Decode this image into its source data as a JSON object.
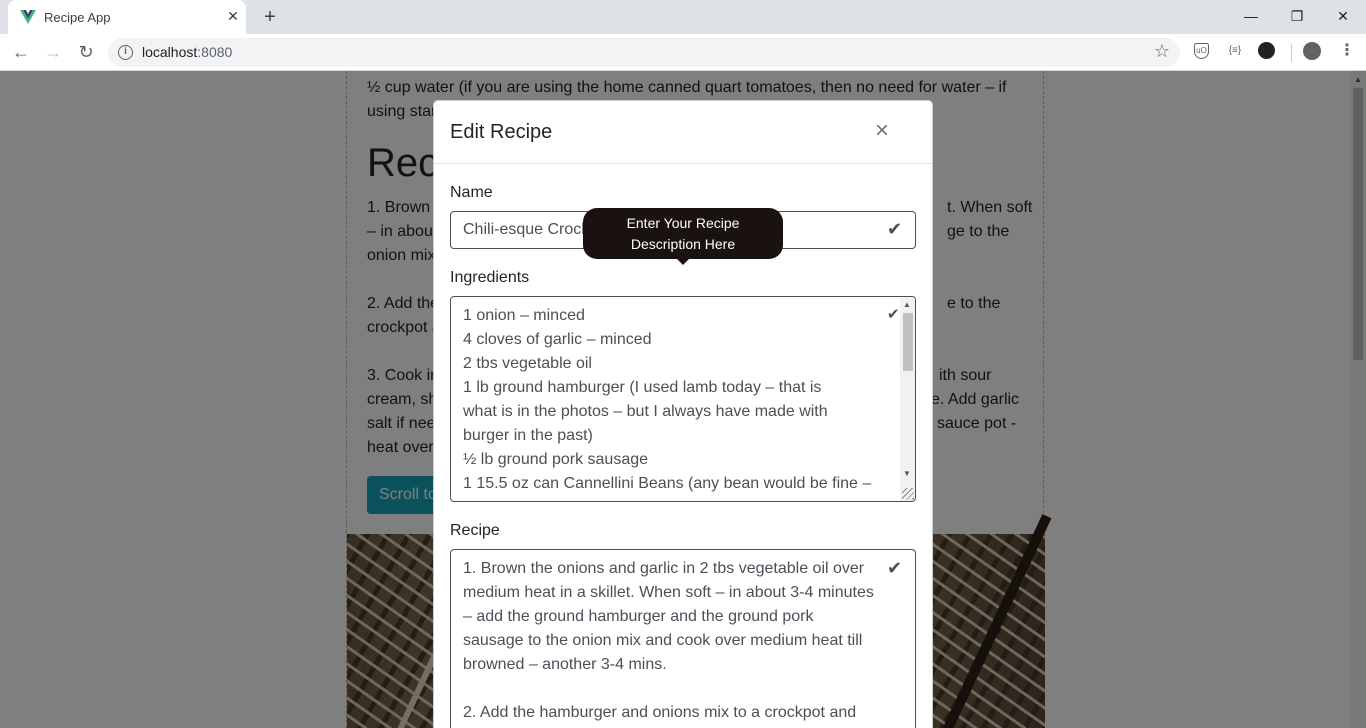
{
  "browser": {
    "tab_title": "Recipe App",
    "tab_close": "✕",
    "new_tab": "+",
    "url_host": "localhost",
    "url_port": ":8080",
    "window_controls": [
      "—",
      "❐",
      "✕"
    ],
    "nav": {
      "back": "←",
      "forward": "→",
      "reload": "↻"
    },
    "extensions": [
      "ext-shield-icon",
      "ext-braces-icon",
      "ext-circle-icon",
      "profile-icon"
    ]
  },
  "background_page": {
    "line1": "½ cup water (if you are using the home canned quart tomatoes, then no need for water – if",
    "line2": "using star",
    "heading": "Reci",
    "para1": [
      "1. Brown t",
      "– in about",
      "onion mix"
    ],
    "para1_right": [
      "t. When soft",
      "ge to the"
    ],
    "para2": [
      "2. Add the",
      "crockpot a"
    ],
    "para2_right": [
      "e to the"
    ],
    "para3": [
      "3. Cook in",
      "cream, sh",
      "salt if nee",
      "heat over"
    ],
    "para3_right": [
      "ith sour",
      "e. Add garlic",
      "sauce pot -"
    ],
    "button": "Scroll to"
  },
  "modal": {
    "title": "Edit Recipe",
    "close": "×",
    "name_label": "Name",
    "name_value": "Chili-esque Crock",
    "ingredients_label": "Ingredients",
    "ingredients_lines": [
      "1 onion – minced",
      "4 cloves of garlic – minced",
      "2 tbs vegetable oil",
      "1 lb ground hamburger (I used lamb today – that is",
      "what is in the photos – but I always have made with",
      "burger in the past)",
      "½ lb ground pork sausage",
      "1 15.5 oz can Cannellini Beans (any bean would be fine –"
    ],
    "recipe_label": "Recipe",
    "recipe_lines": [
      "1. Brown the onions and garlic in 2 tbs vegetable oil over",
      "medium heat in a skillet. When soft – in about 3-4 minutes",
      "– add the ground hamburger and the ground pork",
      "sausage to the onion mix and cook over medium heat till",
      "browned – another 3-4 mins.",
      "",
      "2. Add the hamburger and onions mix to a crockpot and"
    ],
    "valid_icon": "✔"
  },
  "tooltip": {
    "line1": "Enter Your Recipe",
    "line2": "Description Here"
  }
}
